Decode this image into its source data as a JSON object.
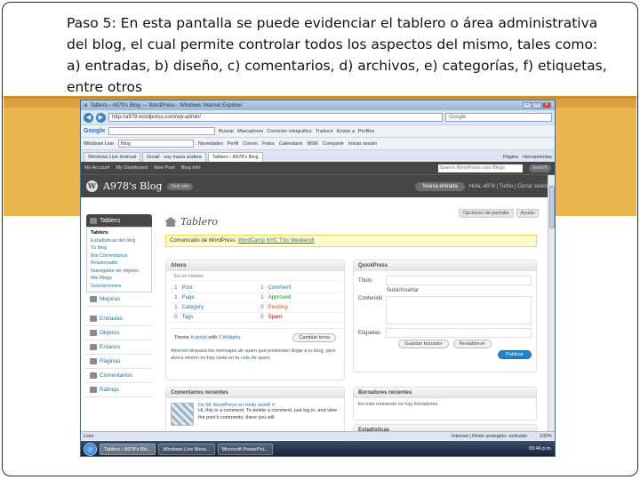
{
  "caption": {
    "text": "Paso 5: En esta pantalla se puede evidenciar el tablero o área administrativa del blog, el cual permite controlar todos los aspectos del mismo, tales como: a) entradas, b) diseño, c) comentarios, d) archivos, e) categorías, f) etiquetas, entre otros"
  },
  "browser": {
    "window_title": "Tablero ‹ A978's Blog — WordPress - Windows Internet Explorer",
    "url": "http://a978.wordpress.com/wp-admin/",
    "search_placeholder": "Google",
    "google_toolbar": {
      "logo": "Google",
      "items": [
        "Buscar",
        "Marcadores",
        "Corrector ortográfico",
        "Traducir",
        "Enviar a",
        "Perfiles"
      ]
    },
    "links_toolbar": {
      "label": "Windows Live",
      "search_value": "Bing",
      "items": [
        "Novedades",
        "Perfil",
        "Correo",
        "Fotos",
        "Calendario",
        "MSN",
        "Compartir",
        "Iniciar sesión"
      ]
    },
    "tabs": [
      {
        "label": "Windows Live Hotmail",
        "active": false
      },
      {
        "label": "Gmail - soy maria andera",
        "active": false
      },
      {
        "label": "Tablero ‹ A978's Blog",
        "active": true
      }
    ],
    "tools": [
      "Página",
      "Herramientas"
    ],
    "status_left": "Listo",
    "status_zone": "Internet | Modo protegido: activado",
    "zoom": "100%"
  },
  "wp": {
    "adminbar": {
      "items": [
        "My Account",
        "My Dashboard",
        "New Post",
        "Blog Info"
      ],
      "search_placeholder": "Search WordPress.com Blogs",
      "search_button": "Search"
    },
    "blog_name": "A978's Blog",
    "visit_site": "Visit site",
    "new_post_button": "Nueva entrada",
    "greeting": "Hola, a978 | Turbo | Cerrar sesión",
    "screen_options": "Opciones de pantalla",
    "help": "Ayuda",
    "page_title": "Tablero",
    "notice_prefix": "Comunicado de WordPress:",
    "notice_link": "WordCamp NYC This Weekend!",
    "sidebar": {
      "header": "Tablero",
      "submenu": [
        "Tablero",
        "Estadísticas del blog",
        "Tu blog",
        "Mis Comentarios",
        "Readomattic",
        "Navegador de objetos",
        "Mis Blogs",
        "Suscripciones"
      ],
      "upgrade": "Mejoras",
      "items": [
        "Entradas",
        "Objetos",
        "Enlaces",
        "Páginas",
        "Comentarios",
        "Ratings"
      ]
    },
    "ahora": {
      "title": "Ahora",
      "subtitle": "En un vistazo",
      "rows": [
        {
          "n1": "1",
          "l1": "Post",
          "n2": "1",
          "l2": "Comment",
          "c2": ""
        },
        {
          "n1": "1",
          "l1": "Page",
          "n2": "1",
          "l2": "Approved",
          "c2": "green"
        },
        {
          "n1": "1",
          "l1": "Category",
          "n2": "0",
          "l2": "Pending",
          "c2": "orange"
        },
        {
          "n1": "0",
          "l1": "Tags",
          "n2": "0",
          "l2": "Spam",
          "c2": "red"
        }
      ],
      "theme_prefix": "Theme",
      "theme_name": "Kubrick",
      "theme_suffix": "with",
      "widgets": "0 Widgets",
      "change_theme": "Cambiar tema",
      "akismet_link": "Akismet",
      "akismet_text": "bloquea los mensajes de spam que pretendan llegar a tu blog, pero ahora mismo no hay nada en tu",
      "akismet_queue": "cola de spam."
    },
    "comments": {
      "title": "Comentarios recientes",
      "meta": "De Mr WordPress en Hello world! #",
      "body": "Hi, this is a comment. To delete a comment, just log in, and view the post's comments, there you will"
    },
    "quickpress": {
      "title": "QuickPress",
      "title_label": "Título",
      "upload_label": "Subir/Insertar",
      "content_label": "Contenido",
      "tags_label": "Etiquetas",
      "save_draft": "Guardar borrador",
      "reset": "Restablecer",
      "publish": "Publicar"
    },
    "drafts": {
      "title": "Borradores recientes",
      "empty": "En este momento no hay borradores."
    },
    "stats": {
      "title": "Estadísticas"
    }
  },
  "taskbar": {
    "tasks": [
      {
        "label": "Tablero ‹ A978's Blo...",
        "active": true
      },
      {
        "label": "Windows Live Mess...",
        "active": false
      },
      {
        "label": "Microsoft PowerPoi...",
        "active": false
      }
    ],
    "clock": "09:46 p.m."
  }
}
